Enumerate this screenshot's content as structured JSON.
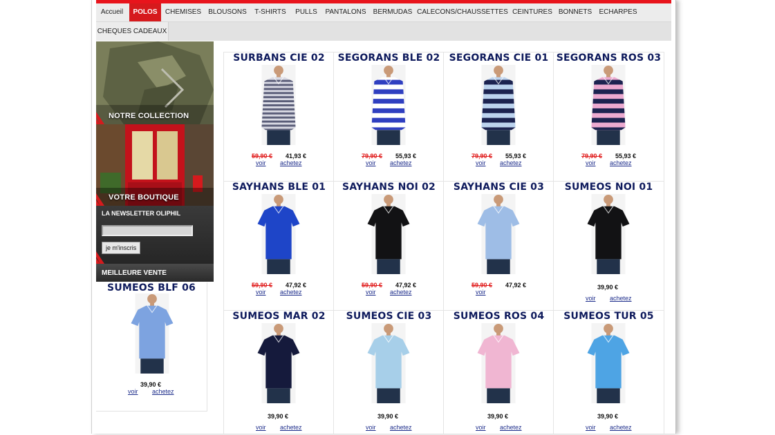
{
  "nav": {
    "items": [
      "Accueil",
      "POLOS",
      "CHEMISES",
      "BLOUSONS",
      "T-SHIRTS",
      "PULLS",
      "PANTALONS",
      "BERMUDAS",
      "CALECONS/CHAUSSETTES",
      "CEINTURES",
      "BONNETS",
      "ECHARPES"
    ],
    "row2": "CHEQUES CADEAUX",
    "active": "POLOS"
  },
  "sidebar": {
    "collection_label": "NOTRE COLLECTION",
    "shop_label": "VOTRE BOUTIQUE",
    "newsletter_title": "LA NEWSLETTER OLIPHIL",
    "newsletter_button": "je m'inscris",
    "newsletter_value": "",
    "best_label": "MEILLEURE VENTE",
    "best_product": {
      "name": "SUMEOS BLF 06",
      "price": "39,90 €",
      "voir": "voir",
      "achetez": "achetez",
      "color": "#7da3e0"
    }
  },
  "products": [
    {
      "name": "SURBANS CIE 02",
      "old": "59,90 €",
      "price": "41,93 €",
      "voir": "voir",
      "achetez": "achetez",
      "style": "thin-stripes",
      "color": "#5a5d78",
      "accent": "#d9dae4"
    },
    {
      "name": "SEGORANS BLE 02",
      "old": "79,90 €",
      "price": "55,93 €",
      "voir": "voir",
      "achetez": "achetez",
      "style": "wide-stripes",
      "color": "#2f3fc0",
      "accent": "#ffffff"
    },
    {
      "name": "SEGORANS CIE 01",
      "old": "79,90 €",
      "price": "55,93 €",
      "voir": "voir",
      "achetez": "achetez",
      "style": "wide-stripes",
      "color": "#1c2350",
      "accent": "#bcd3ee"
    },
    {
      "name": "SEGORANS ROS 03",
      "old": "79,90 €",
      "price": "55,93 €",
      "voir": "voir",
      "achetez": "achetez",
      "style": "wide-stripes",
      "color": "#1c2350",
      "accent": "#ecaad0"
    },
    {
      "name": "SAYHANS BLE 01",
      "old": "59,90 €",
      "price": "47,92 €",
      "voir": "voir",
      "achetez": "achetez",
      "style": "solid",
      "color": "#1e45c8",
      "accent": "#1e45c8"
    },
    {
      "name": "SAYHANS NOI 02",
      "old": "59,90 €",
      "price": "47,92 €",
      "voir": "voir",
      "achetez": "achetez",
      "style": "solid",
      "color": "#121214",
      "accent": "#121214"
    },
    {
      "name": "SAYHANS CIE 03",
      "old": "59,90 €",
      "price": "47,92 €",
      "voir": "voir",
      "achetez": "",
      "style": "solid",
      "color": "#9ebde6",
      "accent": "#9ebde6"
    },
    {
      "name": "SUMEOS NOI 01",
      "old": "",
      "price": "39,90 €",
      "voir": "voir",
      "achetez": "achetez",
      "style": "solid",
      "color": "#121214",
      "accent": "#121214"
    },
    {
      "name": "SUMEOS MAR 02",
      "old": "",
      "price": "39,90 €",
      "voir": "voir",
      "achetez": "achetez",
      "style": "solid",
      "color": "#151a3c",
      "accent": "#151a3c"
    },
    {
      "name": "SUMEOS CIE 03",
      "old": "",
      "price": "39,90 €",
      "voir": "voir",
      "achetez": "achetez",
      "style": "solid",
      "color": "#a7cfe9",
      "accent": "#a7cfe9"
    },
    {
      "name": "SUMEOS ROS 04",
      "old": "",
      "price": "39,90 €",
      "voir": "voir",
      "achetez": "achetez",
      "style": "solid",
      "color": "#f0b6d2",
      "accent": "#f0b6d2"
    },
    {
      "name": "SUMEOS TUR 05",
      "old": "",
      "price": "39,90 €",
      "voir": "voir",
      "achetez": "achetez",
      "style": "solid",
      "color": "#4ea4e4",
      "accent": "#4ea4e4"
    }
  ],
  "colors": {
    "accent_red": "#d61a1d",
    "title_navy": "#0e1a5c",
    "link": "#1b2b8a",
    "old_price": "#e01b1b"
  }
}
